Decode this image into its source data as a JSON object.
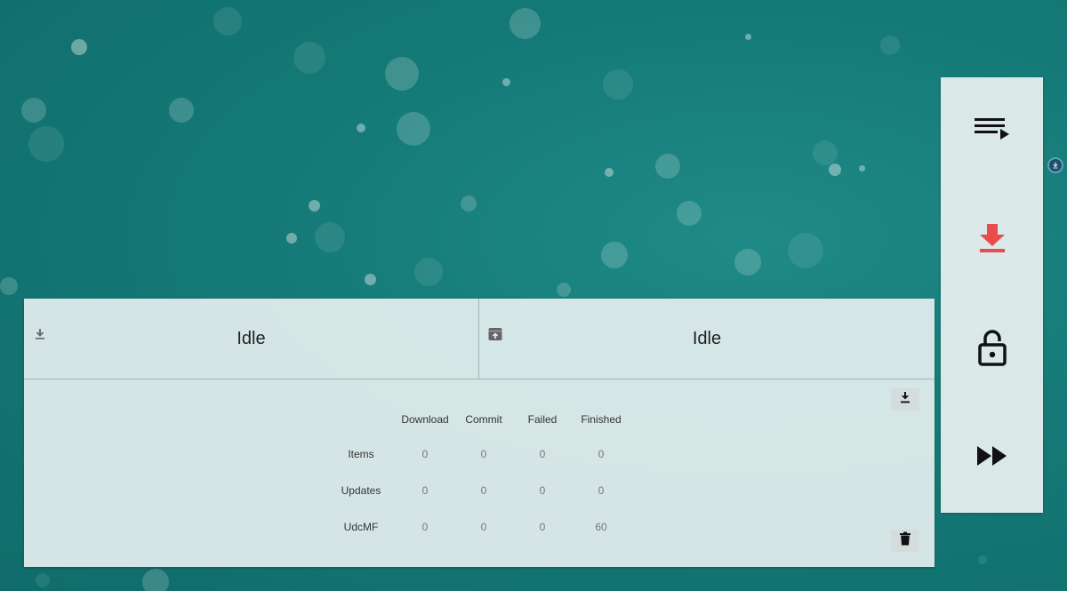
{
  "colors": {
    "background": "#157a77",
    "panel": "#e4eeee",
    "accent_red": "#e84c4c",
    "icon_dark": "#111111"
  },
  "status": {
    "download": {
      "icon": "download-icon",
      "text": "Idle"
    },
    "commit": {
      "icon": "archive-upload-icon",
      "text": "Idle"
    }
  },
  "stats": {
    "columns": [
      "Download",
      "Commit",
      "Failed",
      "Finished"
    ],
    "rows": [
      {
        "label": "Items",
        "values": [
          "0",
          "0",
          "0",
          "0"
        ]
      },
      {
        "label": "Updates",
        "values": [
          "0",
          "0",
          "0",
          "0"
        ]
      },
      {
        "label": "UdcMF",
        "values": [
          "0",
          "0",
          "0",
          "60"
        ]
      }
    ]
  },
  "actions": {
    "download_icon": "download-icon",
    "trash_icon": "trash-icon"
  },
  "side_nav": {
    "items": [
      {
        "icon": "playlist-play-icon",
        "active": false
      },
      {
        "icon": "download-icon",
        "active": true
      },
      {
        "icon": "lock-open-icon",
        "active": false
      },
      {
        "icon": "fast-forward-icon",
        "active": false
      }
    ]
  },
  "edge_handle": {
    "icon": "download-circle-icon"
  }
}
